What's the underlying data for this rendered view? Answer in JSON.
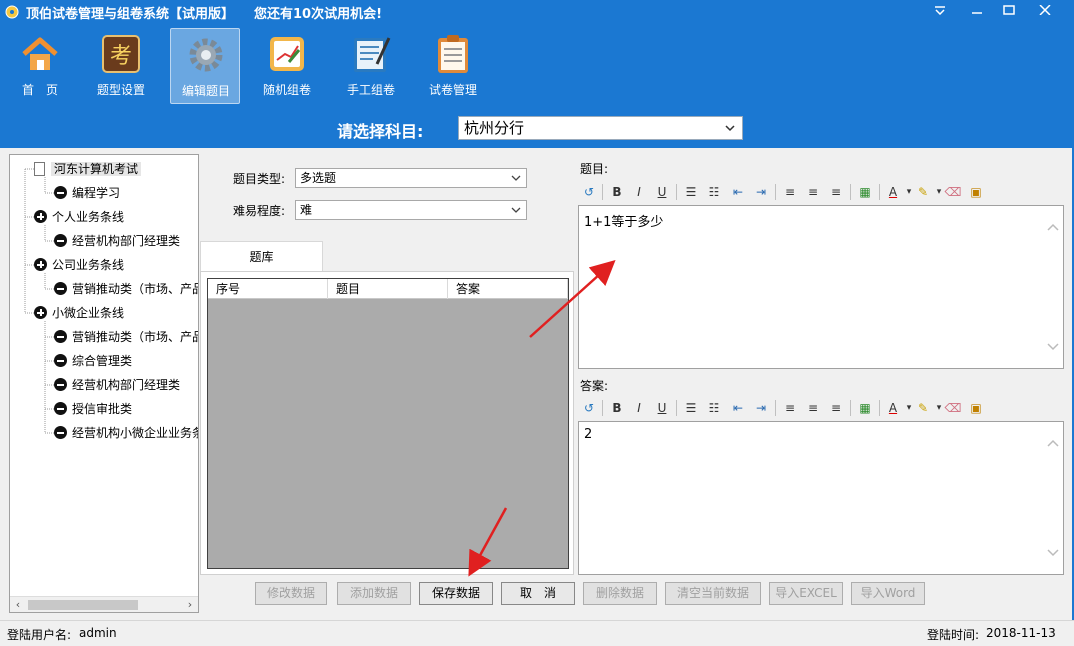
{
  "window": {
    "title": "顶伯试卷管理与组卷系统【试用版】",
    "trial_notice": "您还有10次试用机会!",
    "minimize_glyph": "—",
    "maximize_glyph": "☐",
    "close_glyph": "✕",
    "dropdown_glyph": "▾"
  },
  "toolbar": {
    "items": [
      {
        "label": "首　页",
        "icon": "home-icon"
      },
      {
        "label": "题型设置",
        "icon": "exam-type-icon"
      },
      {
        "label": "编辑题目",
        "icon": "gear-icon",
        "active": true
      },
      {
        "label": "随机组卷",
        "icon": "random-paper-icon"
      },
      {
        "label": "手工组卷",
        "icon": "manual-paper-icon"
      },
      {
        "label": "试卷管理",
        "icon": "clipboard-icon"
      }
    ]
  },
  "subject": {
    "label": "请选择科目:",
    "value": "杭州分行"
  },
  "tree": {
    "root": "河东计算机考试",
    "nodes": [
      {
        "label": "编程学习",
        "type": "minus"
      },
      {
        "label": "个人业务条线",
        "type": "plus"
      },
      {
        "label": "经营机构部门经理类",
        "type": "minus"
      },
      {
        "label": "公司业务条线",
        "type": "plus"
      },
      {
        "label": "营销推动类（市场、产品",
        "type": "minus"
      },
      {
        "label": "小微企业条线",
        "type": "plus"
      },
      {
        "label": "营销推动类（市场、产品",
        "type": "minus"
      },
      {
        "label": "综合管理类",
        "type": "minus"
      },
      {
        "label": "经营机构部门经理类",
        "type": "minus"
      },
      {
        "label": "授信审批类",
        "type": "minus"
      },
      {
        "label": "经营机构小微企业业务条",
        "type": "minus"
      }
    ]
  },
  "form": {
    "type_label": "题目类型:",
    "type_value": "多选题",
    "difficulty_label": "难易程度:",
    "difficulty_value": "难"
  },
  "question_bank": {
    "tab_label": "题库",
    "columns": [
      "序号",
      "题目",
      "答案"
    ]
  },
  "editors": {
    "question_label": "题目:",
    "question_text": "1+1等于多少",
    "answer_label": "答案:",
    "answer_text": "2"
  },
  "buttons": {
    "modify": "修改数据",
    "add": "添加数据",
    "save": "保存数据",
    "cancel": "取　消",
    "delete": "删除数据",
    "clear": "清空当前数据",
    "import_excel": "导入EXCEL",
    "import_word": "导入Word"
  },
  "status": {
    "user_label": "登陆用户名:",
    "user_value": "admin",
    "time_label": "登陆时间:",
    "time_value": "2018-11-13"
  },
  "colors": {
    "header_blue": "#1b78d2",
    "annotation_red": "#e02020"
  }
}
